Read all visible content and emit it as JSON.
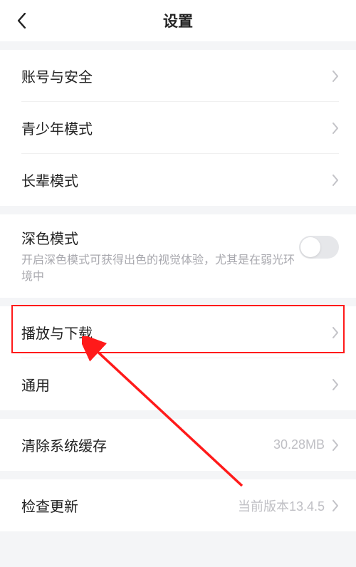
{
  "header": {
    "title": "设置"
  },
  "sections": {
    "account": {
      "label": "账号与安全"
    },
    "youth": {
      "label": "青少年模式"
    },
    "elder": {
      "label": "长辈模式"
    },
    "dark": {
      "label": "深色模式",
      "desc": "开启深色模式可获得出色的视觉体验，尤其是在弱光环境中"
    },
    "playback": {
      "label": "播放与下载"
    },
    "general": {
      "label": "通用"
    },
    "cache": {
      "label": "清除系统缓存",
      "value": "30.28MB"
    },
    "update": {
      "label": "检查更新",
      "value": "当前版本13.4.5"
    }
  },
  "annotation": {
    "highlight_color": "#ff1a1a"
  }
}
